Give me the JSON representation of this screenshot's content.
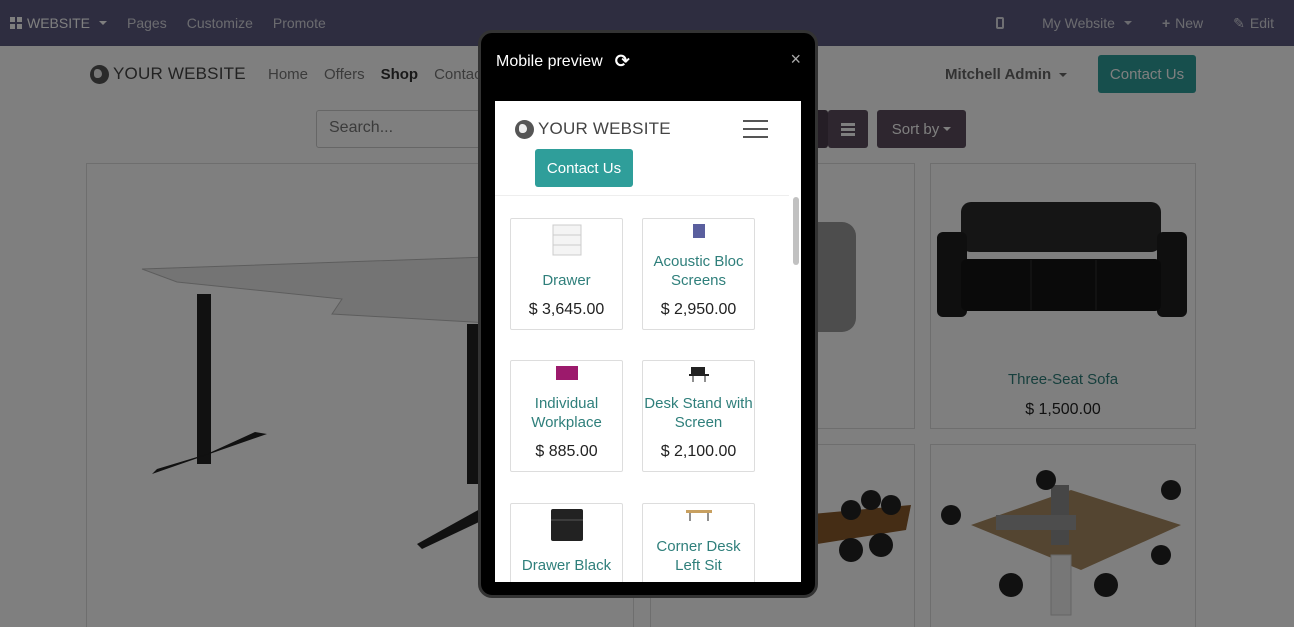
{
  "admin_bar": {
    "brand": "WEBSITE",
    "menu": [
      "Pages",
      "Customize",
      "Promote"
    ],
    "website_selector": "My Website",
    "new_label": "New",
    "edit_label": "Edit"
  },
  "site_nav": {
    "logo_text": "YOUR WEBSITE",
    "links": [
      "Home",
      "Offers",
      "Shop",
      "Contac"
    ],
    "user": "Mitchell Admin",
    "cta": "Contact Us"
  },
  "shop": {
    "search_placeholder": "Search...",
    "sort_label": "Sort by",
    "visible_product": {
      "name": "Three-Seat Sofa",
      "price": "$ 1,500.00"
    }
  },
  "modal": {
    "title": "Mobile preview",
    "close": "×",
    "mobile": {
      "logo_text": "YOUR WEBSITE",
      "cta": "Contact Us",
      "products": [
        {
          "name": "Drawer",
          "price": "$ 3,645.00"
        },
        {
          "name": "Acoustic Bloc Screens",
          "price": "$ 2,950.00"
        },
        {
          "name": "Individual Workplace",
          "price": "$ 885.00"
        },
        {
          "name": "Desk Stand with Screen",
          "price": "$ 2,100.00"
        },
        {
          "name": "Drawer Black",
          "price": ""
        },
        {
          "name": "Corner Desk Left Sit",
          "price": ""
        }
      ]
    }
  },
  "colors": {
    "admin_bg": "#5c5b80",
    "teal": "#2f9e9a",
    "link": "#2f7f7b",
    "dark_btn": "#5c4d5e"
  }
}
